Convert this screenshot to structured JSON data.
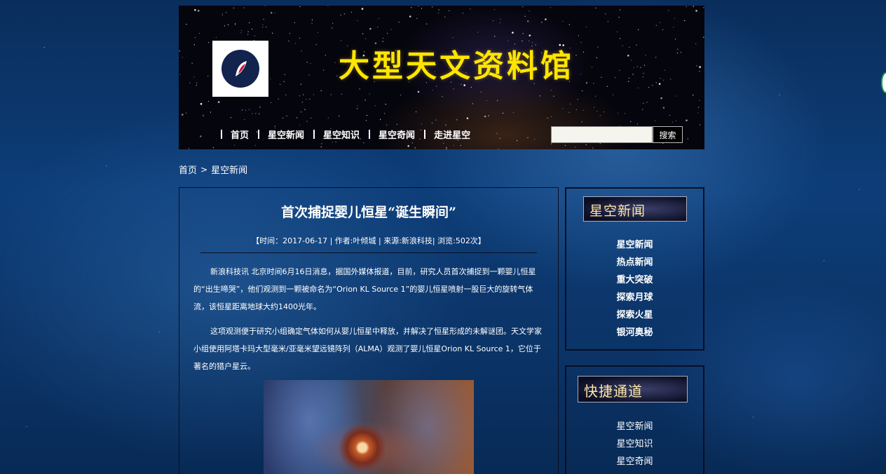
{
  "header": {
    "site_title": "大型天文资料馆",
    "nav": [
      "首页",
      "星空新闻",
      "星空知识",
      "星空奇闻",
      "走进星空"
    ],
    "search": {
      "value": "",
      "button_label": "搜索"
    }
  },
  "breadcrumb": {
    "home": "首页",
    "current": "星空新闻"
  },
  "article": {
    "title": "首次捕捉婴儿恒星“诞生瞬间”",
    "meta": "【时间：2017-06-17 | 作者:叶倾城 | 来源:新浪科技| 浏览:502次】",
    "paragraphs": [
      "新浪科技讯 北京时间6月16日消息，据国外媒体报道，目前，研究人员首次捕捉到一颗婴儿恒星的“出生啼哭”，他们观测到一颗被命名为“Orion KL Source 1”的婴儿恒星喷射一股巨大的旋转气体流，该恒星距离地球大约1400光年。",
      "这项观测便于研究小组确定气体如何从婴儿恒星中释放，并解决了恒星形成的未解谜团。天文学家小组使用阿塔卡玛大型毫米/亚毫米望远镜阵列（ALMA）观测了婴儿恒星Orion KL Source 1，它位于著名的猎户星云。"
    ]
  },
  "sidebar": {
    "news": {
      "heading": "星空新闻",
      "items": [
        "星空新闻",
        "热点新闻",
        "重大突破",
        "探索月球",
        "探索火星",
        "银河奥秘"
      ]
    },
    "quick": {
      "heading": "快捷通道",
      "items": [
        "星空新闻",
        "星空知识",
        "星空奇闻"
      ]
    }
  }
}
